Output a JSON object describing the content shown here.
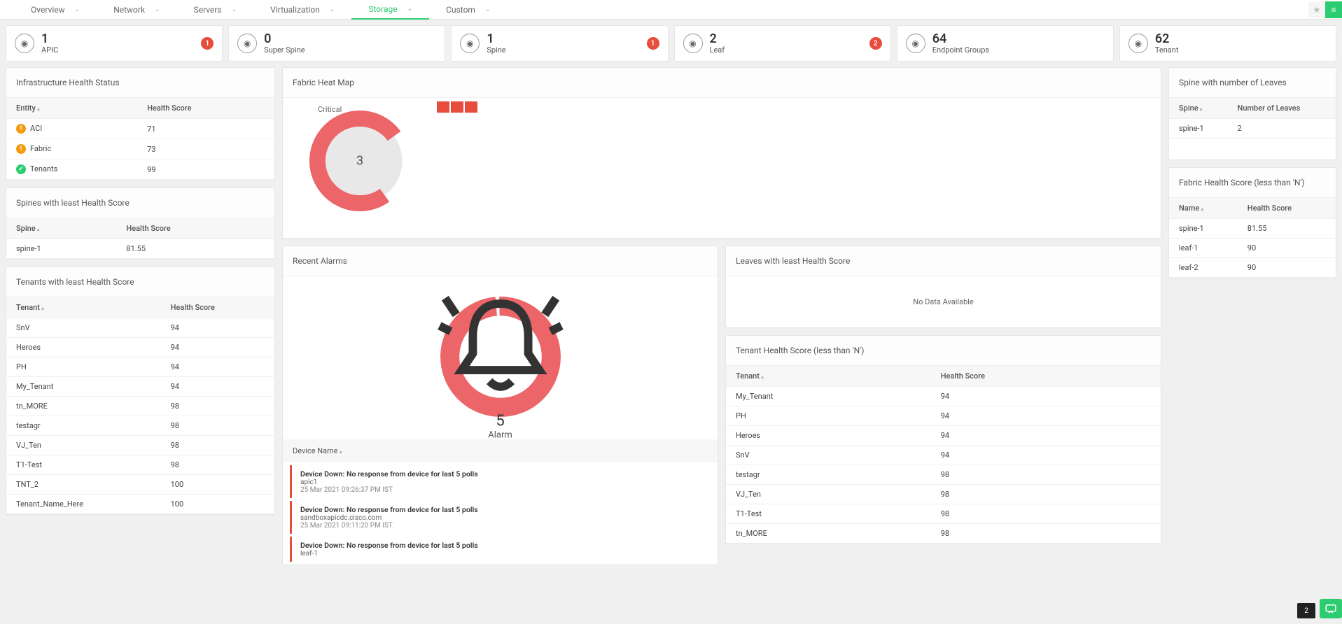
{
  "nav": {
    "tabs": [
      {
        "label": "Overview",
        "active": false
      },
      {
        "label": "Network",
        "active": false
      },
      {
        "label": "Servers",
        "active": false
      },
      {
        "label": "Virtualization",
        "active": false
      },
      {
        "label": "Storage",
        "active": true
      },
      {
        "label": "Custom",
        "active": false
      }
    ]
  },
  "summary": [
    {
      "num": "1",
      "label": "APIC",
      "badge": "1"
    },
    {
      "num": "0",
      "label": "Super Spine",
      "badge": null
    },
    {
      "num": "1",
      "label": "Spine",
      "badge": "1"
    },
    {
      "num": "2",
      "label": "Leaf",
      "badge": "2"
    },
    {
      "num": "64",
      "label": "Endpoint Groups",
      "badge": null
    },
    {
      "num": "62",
      "label": "Tenant",
      "badge": null
    }
  ],
  "infra_health": {
    "title": "Infrastructure Health Status",
    "cols": [
      "Entity",
      "Health Score"
    ],
    "rows": [
      {
        "name": "ACI",
        "score": "71",
        "status": "warn"
      },
      {
        "name": "Fabric",
        "score": "73",
        "status": "warn"
      },
      {
        "name": "Tenants",
        "score": "99",
        "status": "ok"
      }
    ]
  },
  "spines_least": {
    "title": "Spines with least Health Score",
    "cols": [
      "Spine",
      "Health Score"
    ],
    "rows": [
      {
        "name": "spine-1",
        "score": "81.55"
      }
    ]
  },
  "tenants_least": {
    "title": "Tenants with least Health Score",
    "cols": [
      "Tenant",
      "Health Score"
    ],
    "rows": [
      {
        "name": "SnV",
        "score": "94"
      },
      {
        "name": "Heroes",
        "score": "94"
      },
      {
        "name": "PH",
        "score": "94"
      },
      {
        "name": "My_Tenant",
        "score": "94"
      },
      {
        "name": "tn_MORE",
        "score": "98"
      },
      {
        "name": "testagr",
        "score": "98"
      },
      {
        "name": "VJ_Ten",
        "score": "98"
      },
      {
        "name": "T1-Test",
        "score": "98"
      },
      {
        "name": "TNT_2",
        "score": "100"
      },
      {
        "name": "Tenant_Name_Here",
        "score": "100"
      }
    ]
  },
  "heatmap": {
    "title": "Fabric Heat Map",
    "label": "Critical",
    "value": "3"
  },
  "alarms": {
    "title": "Recent Alarms",
    "count": "5",
    "count_label": "Alarm",
    "list_header": "Device Name",
    "items": [
      {
        "msg": "Device Down: No response from device for last 5 polls",
        "dev": "apic1",
        "time": "25 Mar 2021 09:26:37 PM IST"
      },
      {
        "msg": "Device Down: No response from device for last 5 polls",
        "dev": "sandboxapicdc.cisco.com",
        "time": "25 Mar 2021 09:11:20 PM IST"
      },
      {
        "msg": "Device Down: No response from device for last 5 polls",
        "dev": "leaf-1",
        "time": ""
      }
    ]
  },
  "leaves_least": {
    "title": "Leaves with least Health Score",
    "nodata": "No Data Available"
  },
  "tenant_health_n": {
    "title": "Tenant Health Score (less than 'N')",
    "cols": [
      "Tenant",
      "Health Score"
    ],
    "rows": [
      {
        "name": "My_Tenant",
        "score": "94"
      },
      {
        "name": "PH",
        "score": "94"
      },
      {
        "name": "Heroes",
        "score": "94"
      },
      {
        "name": "SnV",
        "score": "94"
      },
      {
        "name": "testagr",
        "score": "98"
      },
      {
        "name": "VJ_Ten",
        "score": "98"
      },
      {
        "name": "T1-Test",
        "score": "98"
      },
      {
        "name": "tn_MORE",
        "score": "98"
      }
    ]
  },
  "spine_leaves": {
    "title": "Spine with number of Leaves",
    "cols": [
      "Spine",
      "Number of Leaves"
    ],
    "rows": [
      {
        "name": "spine-1",
        "score": "2"
      }
    ]
  },
  "fabric_health_n": {
    "title": "Fabric Health Score (less than 'N')",
    "cols": [
      "Name",
      "Health Score"
    ],
    "rows": [
      {
        "name": "spine-1",
        "score": "81.55"
      },
      {
        "name": "leaf-1",
        "score": "90"
      },
      {
        "name": "leaf-2",
        "score": "90"
      }
    ]
  },
  "bottom_badge": "2",
  "chart_data": [
    {
      "type": "pie",
      "title": "Fabric Heat Map",
      "series": [
        {
          "name": "Critical",
          "value": 3
        }
      ],
      "total": 3,
      "colors": {
        "Critical": "#eb6569"
      }
    },
    {
      "type": "pie",
      "title": "Recent Alarms",
      "series": [
        {
          "name": "Alarm",
          "value": 5
        }
      ],
      "total": 5,
      "colors": {
        "Alarm": "#eb6569"
      }
    }
  ]
}
